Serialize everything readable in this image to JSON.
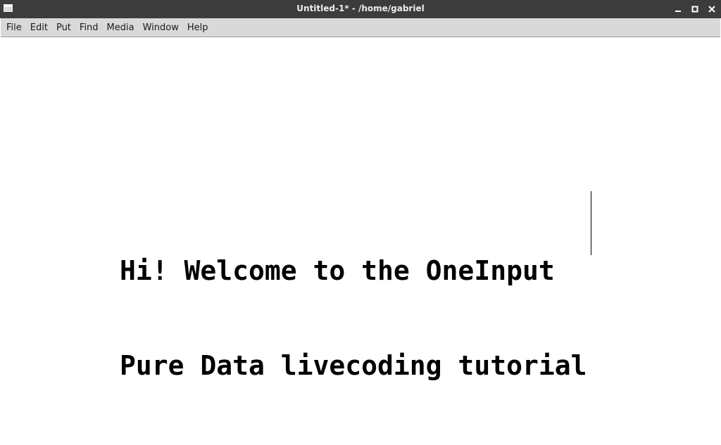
{
  "window": {
    "title": "Untitled-1* - /home/gabriel",
    "icon": "window-icon",
    "controls": [
      "minimize-icon",
      "maximize-icon",
      "close-icon"
    ]
  },
  "menubar": {
    "items": [
      {
        "label": "File"
      },
      {
        "label": "Edit"
      },
      {
        "label": "Put"
      },
      {
        "label": "Find"
      },
      {
        "label": "Media"
      },
      {
        "label": "Window"
      },
      {
        "label": "Help"
      }
    ]
  },
  "canvas": {
    "comment": {
      "lines": [
        "Hi! Welcome to the OneInput",
        "Pure Data livecoding tutorial"
      ]
    }
  },
  "colors": {
    "titlebar": "#3c3c3c",
    "menubar": "#d9d9d9",
    "canvas": "#ffffff",
    "text": "#000000"
  }
}
